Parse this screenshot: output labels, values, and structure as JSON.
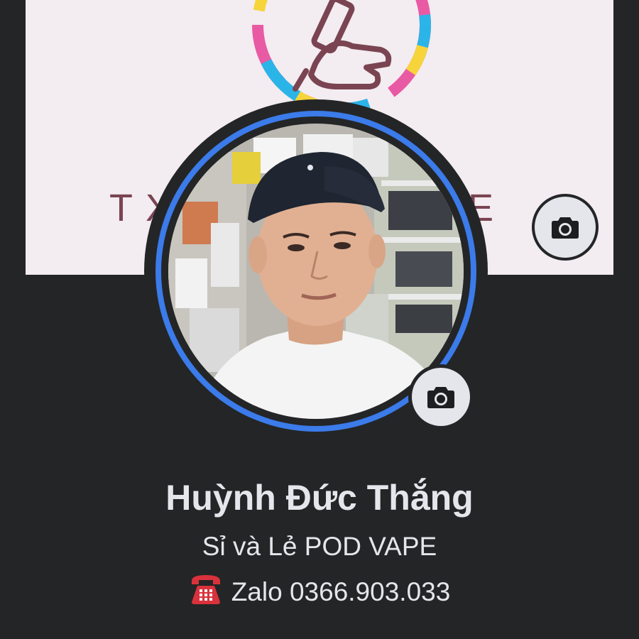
{
  "cover": {
    "brand_left": "TX",
    "brand_right": "RE",
    "camera_icon": "camera-icon"
  },
  "avatar": {
    "camera_icon": "camera-icon"
  },
  "profile": {
    "name": "Huỳnh Đức Thắng",
    "bio_line_1": "Sỉ và Lẻ POD VAPE",
    "bio_line_2": "Zalo 0366.903.033",
    "bio_line_2_icon": "telephone-icon"
  },
  "colors": {
    "background": "#242526",
    "text": "#e4e6eb",
    "avatar_ring": "#3b7bea",
    "cover_bg": "#f3ecf0",
    "brand_text": "#7a4452",
    "button_bg": "#e4e6eb"
  }
}
